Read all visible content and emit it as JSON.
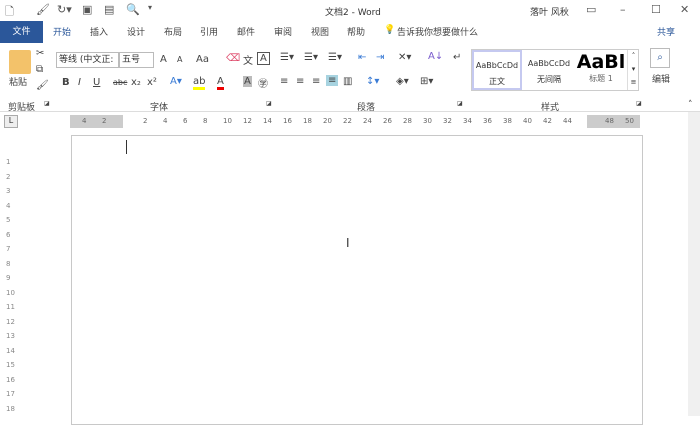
{
  "title_bar": {
    "doc_title": "文档2 - Word",
    "user": "落叶 风秋",
    "icons": [
      "new-doc-icon",
      "format-painter-icon",
      "redo-icon",
      "picture-icon",
      "insert-icon",
      "print-preview-icon",
      "customize-icon"
    ]
  },
  "tabs": {
    "file": "文件",
    "items": [
      "开始",
      "插入",
      "设计",
      "布局",
      "引用",
      "邮件",
      "审阅",
      "视图",
      "帮助"
    ],
    "tell_me": "告诉我你想要做什么",
    "share": "共享"
  },
  "ribbon": {
    "clipboard": {
      "paste": "粘贴",
      "label": "剪贴板"
    },
    "font": {
      "name": "等线 (中文正:",
      "size": "五号",
      "bold": "B",
      "italic": "I",
      "underline": "U",
      "strike": "abc",
      "sub": "x₂",
      "sup": "x²",
      "grow": "A",
      "shrink": "A",
      "case": "Aa",
      "label": "字体"
    },
    "paragraph": {
      "label": "段落"
    },
    "styles": {
      "items": [
        {
          "preview": "AaBbCcDd",
          "name": "正文"
        },
        {
          "preview": "AaBbCcDd",
          "name": "无间隔"
        },
        {
          "preview": "AaBl",
          "name": "标题 1"
        }
      ],
      "label": "样式"
    },
    "editing": {
      "label": "编辑"
    }
  },
  "ruler": {
    "left": [
      "4",
      "2"
    ],
    "right": [
      "2",
      "4",
      "6",
      "8",
      "10",
      "12",
      "14",
      "16",
      "18",
      "20",
      "22",
      "24",
      "26",
      "28",
      "30",
      "32",
      "34",
      "36",
      "38",
      "40",
      "42",
      "44"
    ],
    "end": [
      "48",
      "50"
    ]
  },
  "vruler": [
    "1",
    "2",
    "3",
    "4",
    "5",
    "6",
    "7",
    "8",
    "9",
    "10",
    "11",
    "12",
    "13",
    "14",
    "15",
    "16",
    "17",
    "18"
  ],
  "accent": "#2b579a"
}
